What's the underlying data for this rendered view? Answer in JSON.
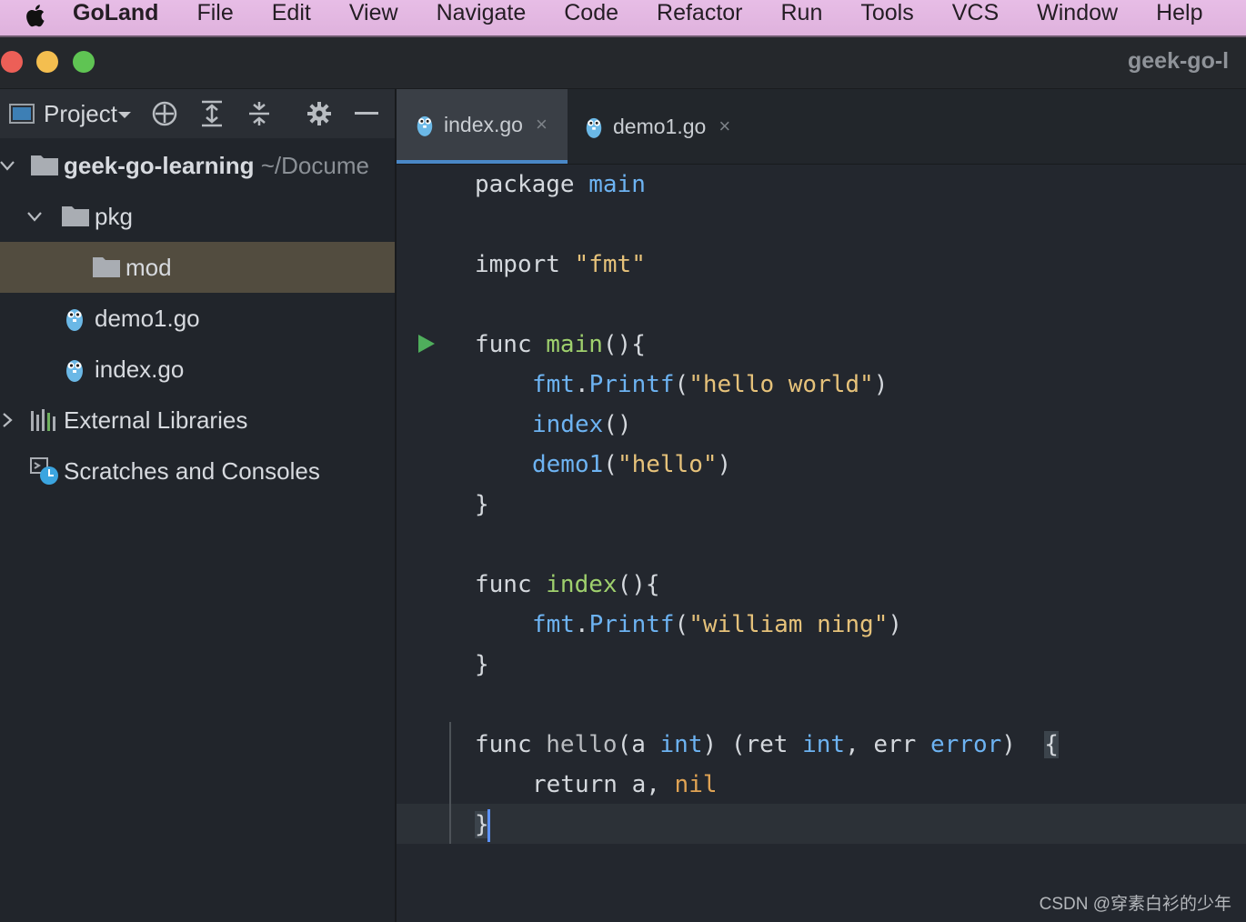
{
  "menubar": {
    "app": "GoLand",
    "items": [
      "File",
      "Edit",
      "View",
      "Navigate",
      "Code",
      "Refactor",
      "Run",
      "Tools",
      "VCS",
      "Window",
      "Help"
    ]
  },
  "window": {
    "title": "geek-go-l"
  },
  "project_panel": {
    "label": "Project",
    "tree": [
      {
        "name": "geek-go-learning",
        "path": "~/Docume"
      },
      {
        "name": "pkg"
      },
      {
        "name": "mod"
      },
      {
        "name": "demo1.go"
      },
      {
        "name": "index.go"
      },
      {
        "name": "External Libraries"
      },
      {
        "name": "Scratches and Consoles"
      }
    ]
  },
  "tabs": [
    {
      "label": "index.go",
      "close": "×"
    },
    {
      "label": "demo1.go",
      "close": "×"
    }
  ],
  "code": {
    "l1": [
      "package",
      "main"
    ],
    "l2": [
      "import",
      "\"fmt\""
    ],
    "l3": [
      "func",
      "main",
      "(){"
    ],
    "l4": [
      "fmt",
      ".",
      "Printf",
      "(",
      "\"hello world\"",
      ")"
    ],
    "l5": [
      "index",
      "()"
    ],
    "l6": [
      "demo1",
      "(",
      "\"hello\"",
      ")"
    ],
    "l7": [
      "}"
    ],
    "l8": [
      "func",
      "index",
      "(){"
    ],
    "l9": [
      "fmt",
      ".",
      "Printf",
      "(",
      "\"william ning\"",
      ")"
    ],
    "l10": [
      "}"
    ],
    "l11": [
      "func",
      "hello",
      "(a",
      "int",
      ")",
      "(ret",
      "int",
      ",",
      "err",
      "error",
      ")",
      "{"
    ],
    "l12": [
      "return",
      "a,",
      "nil"
    ],
    "l13": [
      "}"
    ]
  },
  "watermark": "CSDN @穿素白衫的少年",
  "colors": {
    "accent": "#4a88c7",
    "selection": "#524c3f",
    "string": "#e6c27a",
    "func": "#9fd06d"
  }
}
